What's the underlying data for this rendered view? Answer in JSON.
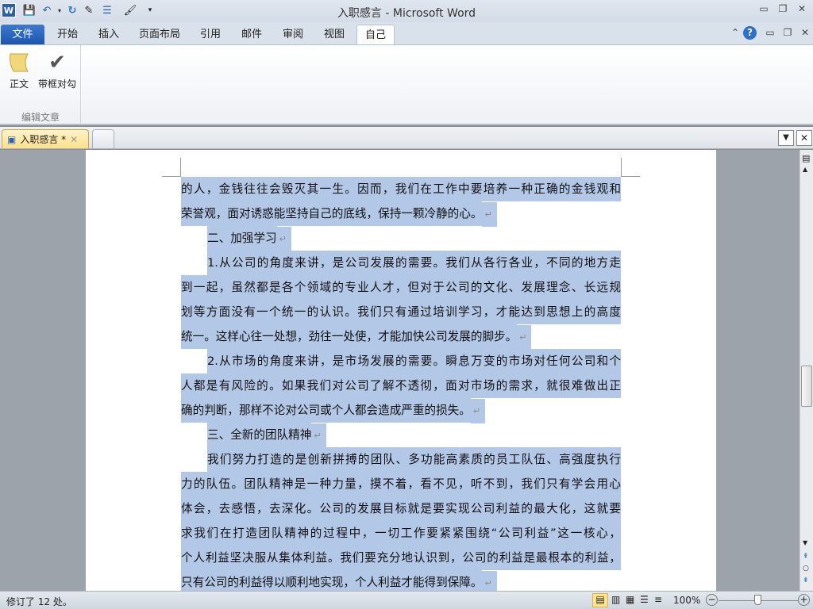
{
  "window": {
    "title": "入职感言 - Microsoft Word"
  },
  "ribbon_tabs": [
    "文件",
    "开始",
    "插入",
    "页面布局",
    "引用",
    "邮件",
    "审阅",
    "视图",
    "自己"
  ],
  "ribbon": {
    "buttons": [
      "正文",
      "带框对勾"
    ],
    "group_label": "编辑文章"
  },
  "document_tab": {
    "name": "入职感言 *"
  },
  "document": {
    "lines": [
      {
        "text": "的人，金钱往往会毁灭其一生。因而，我们在工作中要培养一种正确的金钱观和",
        "indent": false,
        "end": false
      },
      {
        "text": "荣誉观，面对诱惑能坚持自己的底线，保持一颗冷静的心。",
        "indent": false,
        "end": true
      },
      {
        "text": "二、加强学习",
        "indent": true,
        "end": true
      },
      {
        "text": "1.从公司的角度来讲，是公司发展的需要。我们从各行各业，不同的地方走",
        "indent": true,
        "end": false
      },
      {
        "text": "到一起，虽然都是各个领域的专业人才，但对于公司的文化、发展理念、长远规",
        "indent": false,
        "end": false
      },
      {
        "text": "划等方面没有一个统一的认识。我们只有通过培训学习，才能达到思想上的高度",
        "indent": false,
        "end": false
      },
      {
        "text": "统一。这样心往一处想，劲往一处使，才能加快公司发展的脚步。",
        "indent": false,
        "end": true
      },
      {
        "text": "2.从市场的角度来讲，是市场发展的需要。瞬息万变的市场对任何公司和个",
        "indent": true,
        "end": false
      },
      {
        "text": "人都是有风险的。如果我们对公司了解不透彻，面对市场的需求，就很难做出正",
        "indent": false,
        "end": false
      },
      {
        "text": "确的判断，那样不论对公司或个人都会造成严重的损失。",
        "indent": false,
        "end": true
      },
      {
        "text": "三、全新的团队精神",
        "indent": true,
        "end": true
      },
      {
        "text": "我们努力打造的是创新拼搏的团队、多功能高素质的员工队伍、高强度执行",
        "indent": true,
        "end": false
      },
      {
        "text": "力的队伍。团队精神是一种力量，摸不着，看不见，听不到，我们只有学会用心",
        "indent": false,
        "end": false
      },
      {
        "text": "体会，去感悟，去深化。公司的发展目标就是要实现公司利益的最大化，这就要",
        "indent": false,
        "end": false
      },
      {
        "text": "求我们在打造团队精神的过程中，一切工作要紧紧围绕“公司利益”这一核心，",
        "indent": false,
        "end": false
      },
      {
        "text": "个人利益坚决服从集体利益。我们要充分地认识到，公司的利益是最根本的利益，",
        "indent": false,
        "end": false
      },
      {
        "text": "只有公司的利益得以顺利地实现，个人利益才能得到保障。",
        "indent": false,
        "end": true
      }
    ],
    "paragraph_mark": "↵"
  },
  "status": {
    "revisions": "修订了 12 处。",
    "zoom": "100%"
  },
  "colors": {
    "selection": "#b3c7e6",
    "file_tab": "#2a63bd"
  }
}
